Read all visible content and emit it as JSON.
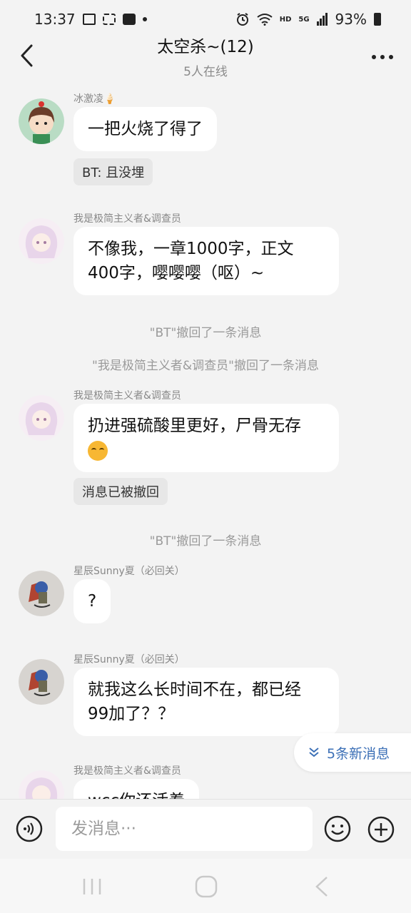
{
  "status_bar": {
    "time": "13:37",
    "hd": "HD",
    "network": "5G",
    "battery": "93%"
  },
  "header": {
    "title": "太空杀~(12)",
    "subtitle": "5人在线"
  },
  "messages": [
    {
      "sender": "冰激凌🍦",
      "text": "一把火烧了得了",
      "reply": "BT: 且没埋"
    },
    {
      "sender": "我是极简主义者&调查员",
      "line1": "不像我，一章1000字，正文",
      "line2": "400字，嘤嘤嘤（呕）~"
    },
    {
      "sender": "我是极简主义者&调查员",
      "text": "扔进强硫酸里更好，尸骨无存",
      "reply": "消息已被撤回"
    },
    {
      "sender": "星辰Sunny夏（必回关）",
      "text": "?"
    },
    {
      "sender": "星辰Sunny夏（必回关）",
      "line1": "就我这么长时间不在，都已经",
      "line2": "99加了？？"
    },
    {
      "sender": "我是极简主义者&调查员",
      "text": "wcc你还活着"
    }
  ],
  "system": {
    "recall1": "\"BT\"撤回了一条消息",
    "recall2": "\"我是极简主义者&调查员\"撤回了一条消息",
    "recall3": "\"BT\"撤回了一条消息"
  },
  "new_messages": "5条新消息",
  "input": {
    "placeholder": "发消息···"
  }
}
